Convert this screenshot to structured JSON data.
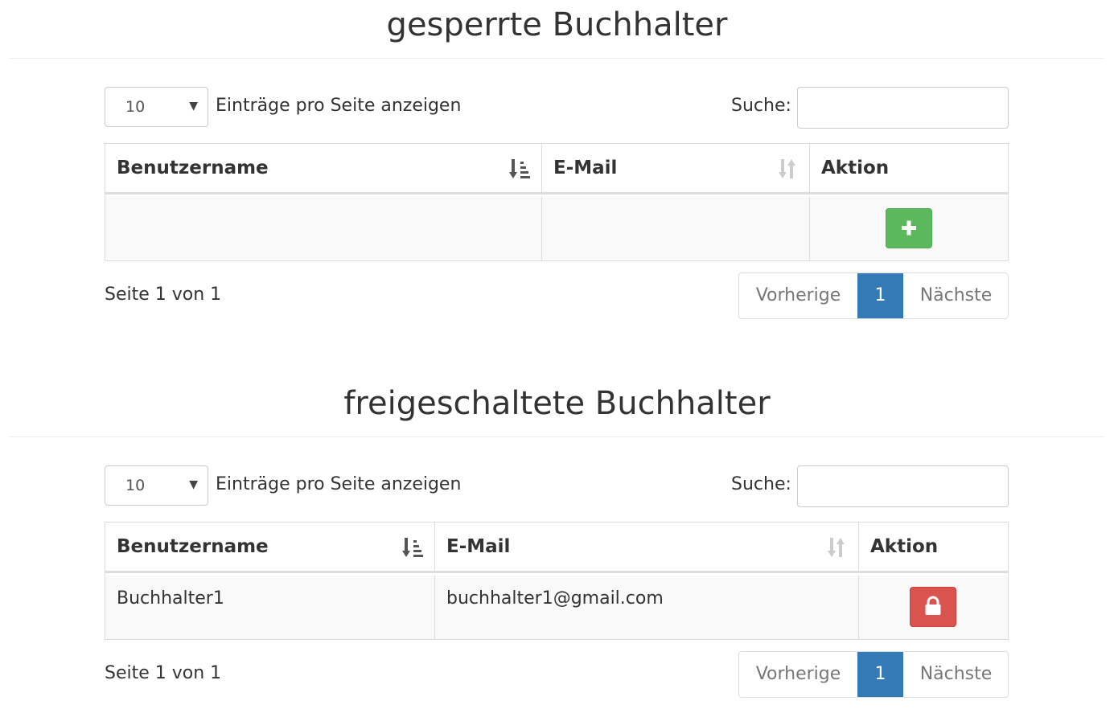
{
  "locked": {
    "title": "gesperrte Buchhalter",
    "length": {
      "value": "10",
      "label": "Einträge pro Seite anzeigen"
    },
    "search": {
      "label": "Suche:",
      "value": ""
    },
    "columns": [
      "Benutzername",
      "E-Mail",
      "Aktion"
    ],
    "rows": [
      {
        "username": "",
        "email": "",
        "action": "plus-icon"
      }
    ],
    "info": "Seite 1 von 1",
    "pagination": {
      "prev": "Vorherige",
      "current": "1",
      "next": "Nächste"
    }
  },
  "unlocked": {
    "title": "freigeschaltete Buchhalter",
    "length": {
      "value": "10",
      "label": "Einträge pro Seite anzeigen"
    },
    "search": {
      "label": "Suche:",
      "value": ""
    },
    "columns": [
      "Benutzername",
      "E-Mail",
      "Aktion"
    ],
    "rows": [
      {
        "username": "Buchhalter1",
        "email": "buchhalter1@gmail.com",
        "action": "lock-icon"
      }
    ],
    "info": "Seite 1 von 1",
    "pagination": {
      "prev": "Vorherige",
      "current": "1",
      "next": "Nächste"
    }
  },
  "colors": {
    "success": "#5cb85c",
    "danger": "#d9534f",
    "primary": "#337ab7"
  }
}
